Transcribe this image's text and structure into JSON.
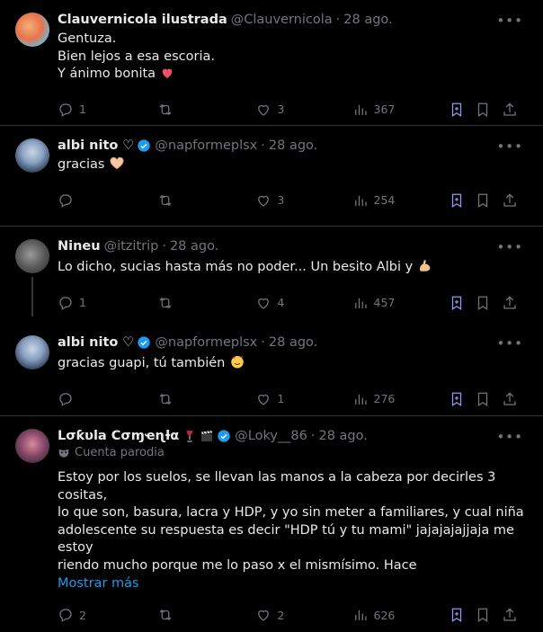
{
  "tweets": [
    {
      "name": "Clauvernicola ilustrada",
      "handle": "@Clauvernicola",
      "date": "28 ago.",
      "verified": false,
      "lines": [
        "Gentuza.",
        "Bien lejos a esa escoria.",
        "Y ánimo bonita"
      ],
      "replies": "1",
      "retweets": "",
      "likes": "3",
      "views": "367"
    },
    {
      "name": "albi nito ♡",
      "handle": "@napformeplsx",
      "date": "28 ago.",
      "verified": true,
      "lines": [
        "gracias"
      ],
      "replies": "",
      "retweets": "",
      "likes": "3",
      "views": "254"
    },
    {
      "name": "Nineu",
      "handle": "@itzitrip",
      "date": "28 ago.",
      "verified": false,
      "lines": [
        "Lo dicho, sucias hasta más no poder... Un besito Albi y"
      ],
      "replies": "1",
      "retweets": "",
      "likes": "4",
      "views": "457"
    },
    {
      "name": "albi nito ♡",
      "handle": "@napformeplsx",
      "date": "28 ago.",
      "verified": true,
      "lines": [
        "gracias guapi, tú también"
      ],
      "replies": "",
      "retweets": "",
      "likes": "1",
      "views": "276"
    },
    {
      "name": "Lσƙυla Cσɱҽɳƚα",
      "handle": "@Loky__86",
      "date": "28 ago.",
      "verified": true,
      "parody_label": "Cuenta parodia",
      "lines": [
        "Estoy por los suelos, se llevan las manos a la cabeza por decirles 3 cositas,",
        "lo que son, basura, lacra y HDP, y yo sin meter a familiares, y cual niña",
        "adolescente su respuesta es decir \"HDP tú y tu mami\" jajajajajjaja me estoy",
        "riendo mucho porque me lo paso x el mismísimo. Hace"
      ],
      "show_more": "Mostrar más",
      "replies": "2",
      "retweets": "",
      "likes": "2",
      "views": "626"
    }
  ],
  "colors": {
    "accent": "#1d9bf0",
    "muted": "#71767b",
    "text": "#e7e9ea",
    "heart_emoji": "#f0506e"
  },
  "icons": [
    "reply-icon",
    "retweet-icon",
    "like-icon",
    "views-icon",
    "grok-icon",
    "bookmark-icon",
    "share-icon",
    "more-icon",
    "verified-badge-icon"
  ]
}
